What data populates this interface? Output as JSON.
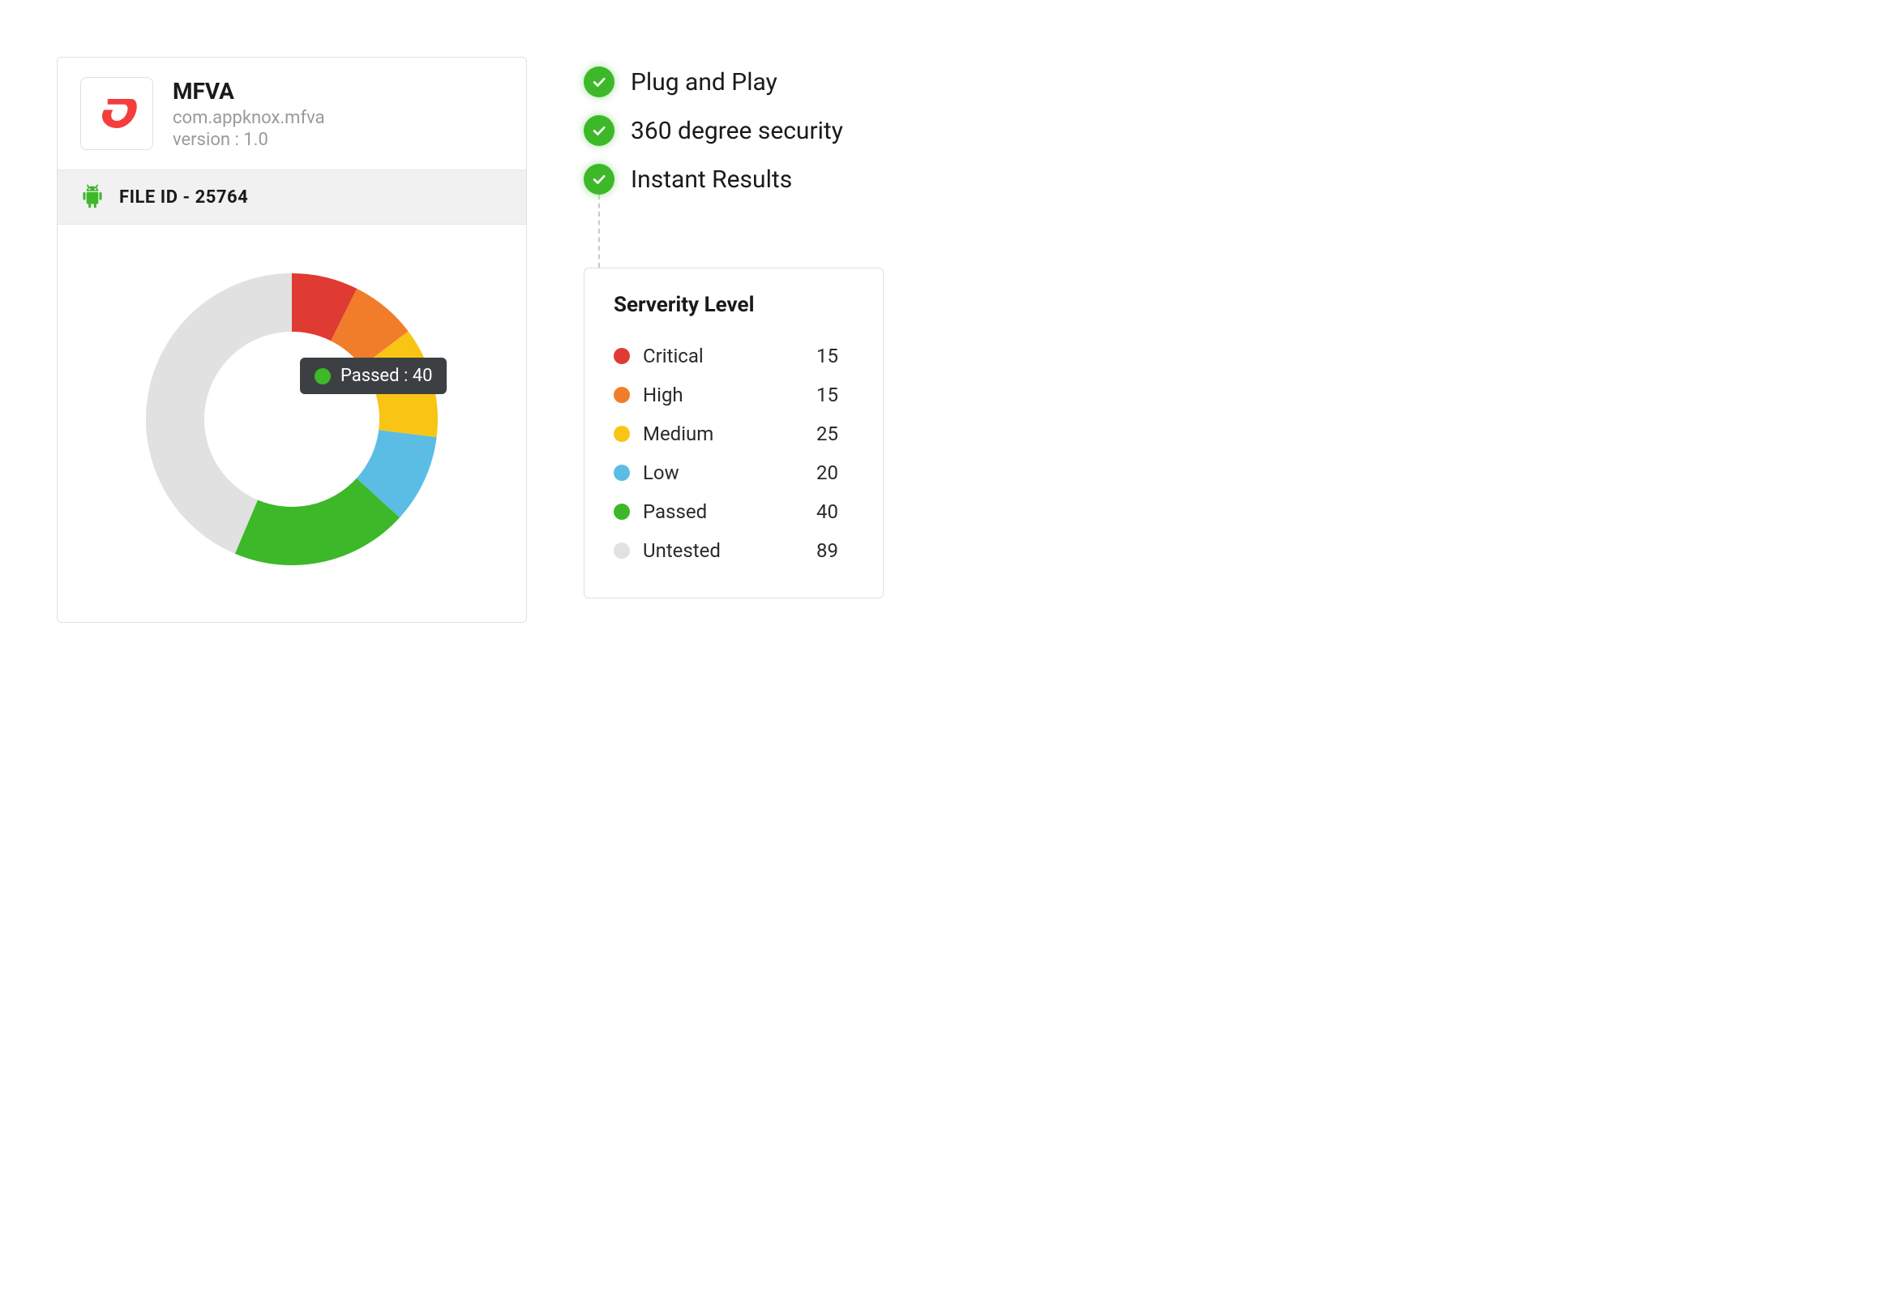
{
  "app": {
    "name": "MFVA",
    "package": "com.appknox.mfva",
    "version_label": "version : 1.0"
  },
  "file_id": {
    "label": "FILE ID - 25764"
  },
  "tooltip": {
    "label": "Passed : 40",
    "color": "#3DB829"
  },
  "features": {
    "items": [
      {
        "label": "Plug and Play"
      },
      {
        "label": "360 degree security"
      },
      {
        "label": "Instant Results"
      }
    ]
  },
  "severity": {
    "title": "Serverity Level",
    "rows": [
      {
        "label": "Critical",
        "value": 15,
        "color": "#E03B32"
      },
      {
        "label": "High",
        "value": 15,
        "color": "#F17D2A"
      },
      {
        "label": "Medium",
        "value": 25,
        "color": "#F9C515"
      },
      {
        "label": "Low",
        "value": 20,
        "color": "#5BBCE4"
      },
      {
        "label": "Passed",
        "value": 40,
        "color": "#3DB829"
      },
      {
        "label": "Untested",
        "value": 89,
        "color": "#E1E1E1"
      }
    ]
  },
  "chart_data": {
    "type": "pie",
    "title": "",
    "categories": [
      "Critical",
      "High",
      "Medium",
      "Low",
      "Passed",
      "Untested"
    ],
    "values": [
      15,
      15,
      25,
      20,
      40,
      89
    ],
    "colors": [
      "#E03B32",
      "#F17D2A",
      "#F9C515",
      "#5BBCE4",
      "#3DB829",
      "#E1E1E1"
    ],
    "tooltip": {
      "label": "Passed",
      "value": 40
    }
  }
}
